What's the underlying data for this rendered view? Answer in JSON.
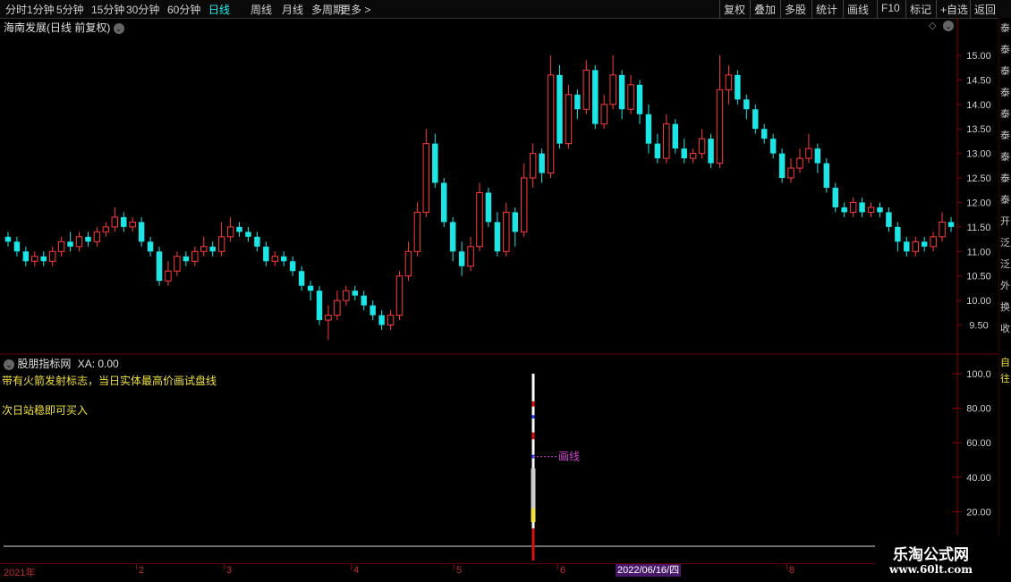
{
  "toolbar": {
    "left_items": [
      "分时",
      "1分钟",
      "5分钟",
      "15分钟",
      "30分钟",
      "60分钟",
      "日线",
      "周线",
      "月线",
      "多周期",
      "更多 >"
    ],
    "active": "日线",
    "right_items": [
      "复权",
      "叠加",
      "多股",
      "统计",
      "画线",
      "F10",
      "标记",
      "+自选",
      "返回"
    ]
  },
  "main_pane": {
    "title": "海南发展(日线 前复权)",
    "y_ticks": [
      "15.00",
      "14.50",
      "14.00",
      "13.50",
      "13.00",
      "12.50",
      "12.00",
      "11.50",
      "11.00",
      "10.50",
      "10.00",
      "9.50"
    ]
  },
  "indicator_pane": {
    "title": "股朋指标网",
    "value": "XA: 0.00",
    "note1": "带有火箭发射标志，当日实体最高价画试盘线",
    "note2": "次日站稳即可买入",
    "line_label": "画线",
    "y_ticks": [
      "100.0",
      "80.00",
      "60.00",
      "40.00",
      "20.00"
    ]
  },
  "x_axis": {
    "months": [
      "2021年",
      "2",
      "3",
      "4",
      "5",
      "6",
      "8"
    ],
    "cursor_date": "2022/06/16/四"
  },
  "right_strip_glyphs": [
    "泰",
    "泰",
    "泰",
    "泰",
    "泰",
    "泰",
    "泰",
    "泰",
    "泰",
    "开",
    "泛",
    "泛",
    "外",
    "换",
    "收"
  ],
  "right_strip_glyphs_lower": [
    "自",
    "往"
  ],
  "logo": {
    "name": "乐淘公式网",
    "url": "www.60lt.com"
  },
  "colors": {
    "up": "#ff3b3b",
    "down": "#1ee5e5",
    "accent": "#1ef0f0",
    "note": "#f0e040",
    "grid": "#5a0000"
  },
  "chart_data": {
    "type": "candlestick",
    "ylim": [
      9.2,
      15.4
    ],
    "series": [
      {
        "o": 11.3,
        "c": 11.2,
        "h": 11.4,
        "l": 11.1
      },
      {
        "o": 11.2,
        "c": 11.0,
        "h": 11.3,
        "l": 10.9
      },
      {
        "o": 11.0,
        "c": 10.8,
        "h": 11.1,
        "l": 10.7
      },
      {
        "o": 10.8,
        "c": 10.9,
        "h": 11.0,
        "l": 10.7
      },
      {
        "o": 10.9,
        "c": 10.8,
        "h": 11.0,
        "l": 10.7
      },
      {
        "o": 10.8,
        "c": 11.0,
        "h": 11.1,
        "l": 10.7
      },
      {
        "o": 11.0,
        "c": 11.2,
        "h": 11.3,
        "l": 10.9
      },
      {
        "o": 11.2,
        "c": 11.1,
        "h": 11.4,
        "l": 11.0
      },
      {
        "o": 11.1,
        "c": 11.3,
        "h": 11.4,
        "l": 11.0
      },
      {
        "o": 11.3,
        "c": 11.2,
        "h": 11.4,
        "l": 11.1
      },
      {
        "o": 11.2,
        "c": 11.4,
        "h": 11.5,
        "l": 11.1
      },
      {
        "o": 11.4,
        "c": 11.5,
        "h": 11.6,
        "l": 11.3
      },
      {
        "o": 11.5,
        "c": 11.7,
        "h": 11.9,
        "l": 11.4
      },
      {
        "o": 11.7,
        "c": 11.5,
        "h": 11.8,
        "l": 11.4
      },
      {
        "o": 11.5,
        "c": 11.6,
        "h": 11.7,
        "l": 11.4
      },
      {
        "o": 11.6,
        "c": 11.2,
        "h": 11.7,
        "l": 11.1
      },
      {
        "o": 11.2,
        "c": 11.0,
        "h": 11.3,
        "l": 10.9
      },
      {
        "o": 11.0,
        "c": 10.4,
        "h": 11.1,
        "l": 10.3
      },
      {
        "o": 10.4,
        "c": 10.6,
        "h": 10.8,
        "l": 10.3
      },
      {
        "o": 10.6,
        "c": 10.9,
        "h": 11.0,
        "l": 10.5
      },
      {
        "o": 10.9,
        "c": 10.8,
        "h": 11.0,
        "l": 10.7
      },
      {
        "o": 10.8,
        "c": 11.0,
        "h": 11.1,
        "l": 10.7
      },
      {
        "o": 11.0,
        "c": 11.1,
        "h": 11.3,
        "l": 10.9
      },
      {
        "o": 11.1,
        "c": 11.0,
        "h": 11.2,
        "l": 10.9
      },
      {
        "o": 11.0,
        "c": 11.3,
        "h": 11.6,
        "l": 10.9
      },
      {
        "o": 11.3,
        "c": 11.5,
        "h": 11.7,
        "l": 11.2
      },
      {
        "o": 11.5,
        "c": 11.4,
        "h": 11.6,
        "l": 11.3
      },
      {
        "o": 11.4,
        "c": 11.3,
        "h": 11.5,
        "l": 11.2
      },
      {
        "o": 11.3,
        "c": 11.1,
        "h": 11.4,
        "l": 11.0
      },
      {
        "o": 11.1,
        "c": 10.8,
        "h": 11.2,
        "l": 10.7
      },
      {
        "o": 10.8,
        "c": 10.9,
        "h": 11.0,
        "l": 10.7
      },
      {
        "o": 10.9,
        "c": 10.8,
        "h": 11.0,
        "l": 10.7
      },
      {
        "o": 10.8,
        "c": 10.6,
        "h": 10.9,
        "l": 10.5
      },
      {
        "o": 10.6,
        "c": 10.3,
        "h": 10.7,
        "l": 10.2
      },
      {
        "o": 10.3,
        "c": 10.2,
        "h": 10.4,
        "l": 10.0
      },
      {
        "o": 10.2,
        "c": 9.6,
        "h": 10.3,
        "l": 9.5
      },
      {
        "o": 9.6,
        "c": 9.7,
        "h": 9.9,
        "l": 9.2
      },
      {
        "o": 9.7,
        "c": 10.0,
        "h": 10.2,
        "l": 9.6
      },
      {
        "o": 10.0,
        "c": 10.2,
        "h": 10.3,
        "l": 9.9
      },
      {
        "o": 10.2,
        "c": 10.1,
        "h": 10.3,
        "l": 10.0
      },
      {
        "o": 10.1,
        "c": 9.9,
        "h": 10.2,
        "l": 9.8
      },
      {
        "o": 9.9,
        "c": 9.7,
        "h": 10.0,
        "l": 9.6
      },
      {
        "o": 9.7,
        "c": 9.5,
        "h": 9.8,
        "l": 9.4
      },
      {
        "o": 9.5,
        "c": 9.7,
        "h": 9.8,
        "l": 9.4
      },
      {
        "o": 9.7,
        "c": 10.5,
        "h": 10.6,
        "l": 9.6
      },
      {
        "o": 10.5,
        "c": 11.0,
        "h": 11.2,
        "l": 10.4
      },
      {
        "o": 11.0,
        "c": 11.8,
        "h": 12.0,
        "l": 10.9
      },
      {
        "o": 11.8,
        "c": 13.2,
        "h": 13.5,
        "l": 11.7
      },
      {
        "o": 13.2,
        "c": 12.4,
        "h": 13.4,
        "l": 12.3
      },
      {
        "o": 12.4,
        "c": 11.6,
        "h": 12.5,
        "l": 11.5
      },
      {
        "o": 11.6,
        "c": 11.0,
        "h": 11.7,
        "l": 10.8
      },
      {
        "o": 11.0,
        "c": 10.7,
        "h": 11.2,
        "l": 10.5
      },
      {
        "o": 10.7,
        "c": 11.1,
        "h": 11.3,
        "l": 10.6
      },
      {
        "o": 11.1,
        "c": 12.2,
        "h": 12.4,
        "l": 11.0
      },
      {
        "o": 12.2,
        "c": 11.6,
        "h": 12.3,
        "l": 11.5
      },
      {
        "o": 11.6,
        "c": 11.0,
        "h": 11.8,
        "l": 10.9
      },
      {
        "o": 11.0,
        "c": 11.8,
        "h": 12.0,
        "l": 10.9
      },
      {
        "o": 11.8,
        "c": 11.4,
        "h": 11.9,
        "l": 11.1
      },
      {
        "o": 11.4,
        "c": 12.5,
        "h": 12.8,
        "l": 11.3
      },
      {
        "o": 12.5,
        "c": 13.0,
        "h": 13.2,
        "l": 12.3
      },
      {
        "o": 13.0,
        "c": 12.6,
        "h": 13.1,
        "l": 12.4
      },
      {
        "o": 12.6,
        "c": 14.6,
        "h": 15.0,
        "l": 12.5
      },
      {
        "o": 14.6,
        "c": 13.2,
        "h": 14.8,
        "l": 13.1
      },
      {
        "o": 13.2,
        "c": 14.2,
        "h": 14.4,
        "l": 13.1
      },
      {
        "o": 14.2,
        "c": 13.9,
        "h": 14.3,
        "l": 13.7
      },
      {
        "o": 13.9,
        "c": 14.7,
        "h": 14.9,
        "l": 13.8
      },
      {
        "o": 14.7,
        "c": 13.6,
        "h": 14.8,
        "l": 13.5
      },
      {
        "o": 13.6,
        "c": 14.0,
        "h": 14.2,
        "l": 13.5
      },
      {
        "o": 14.0,
        "c": 14.6,
        "h": 15.0,
        "l": 13.9
      },
      {
        "o": 14.6,
        "c": 13.9,
        "h": 14.7,
        "l": 13.7
      },
      {
        "o": 13.9,
        "c": 14.4,
        "h": 14.6,
        "l": 13.8
      },
      {
        "o": 14.4,
        "c": 13.8,
        "h": 14.5,
        "l": 13.6
      },
      {
        "o": 13.8,
        "c": 13.2,
        "h": 14.0,
        "l": 13.0
      },
      {
        "o": 13.2,
        "c": 12.9,
        "h": 13.4,
        "l": 12.8
      },
      {
        "o": 12.9,
        "c": 13.6,
        "h": 13.8,
        "l": 12.8
      },
      {
        "o": 13.6,
        "c": 13.1,
        "h": 13.7,
        "l": 13.0
      },
      {
        "o": 13.1,
        "c": 12.9,
        "h": 13.3,
        "l": 12.8
      },
      {
        "o": 12.9,
        "c": 13.0,
        "h": 13.1,
        "l": 12.8
      },
      {
        "o": 13.0,
        "c": 13.3,
        "h": 13.5,
        "l": 12.9
      },
      {
        "o": 13.3,
        "c": 12.8,
        "h": 13.4,
        "l": 12.7
      },
      {
        "o": 12.8,
        "c": 14.3,
        "h": 15.0,
        "l": 12.7
      },
      {
        "o": 14.3,
        "c": 14.6,
        "h": 14.8,
        "l": 14.0
      },
      {
        "o": 14.6,
        "c": 14.1,
        "h": 14.7,
        "l": 14.0
      },
      {
        "o": 14.1,
        "c": 13.9,
        "h": 14.2,
        "l": 13.7
      },
      {
        "o": 13.9,
        "c": 13.5,
        "h": 14.0,
        "l": 13.4
      },
      {
        "o": 13.5,
        "c": 13.3,
        "h": 13.6,
        "l": 13.2
      },
      {
        "o": 13.3,
        "c": 13.0,
        "h": 13.4,
        "l": 12.9
      },
      {
        "o": 13.0,
        "c": 12.5,
        "h": 13.1,
        "l": 12.4
      },
      {
        "o": 12.5,
        "c": 12.7,
        "h": 12.9,
        "l": 12.4
      },
      {
        "o": 12.7,
        "c": 12.9,
        "h": 13.1,
        "l": 12.6
      },
      {
        "o": 12.9,
        "c": 13.1,
        "h": 13.4,
        "l": 12.8
      },
      {
        "o": 13.1,
        "c": 12.8,
        "h": 13.2,
        "l": 12.6
      },
      {
        "o": 12.8,
        "c": 12.3,
        "h": 12.9,
        "l": 12.2
      },
      {
        "o": 12.3,
        "c": 11.9,
        "h": 12.4,
        "l": 11.8
      },
      {
        "o": 11.9,
        "c": 11.8,
        "h": 12.0,
        "l": 11.7
      },
      {
        "o": 11.8,
        "c": 12.0,
        "h": 12.1,
        "l": 11.7
      },
      {
        "o": 12.0,
        "c": 11.8,
        "h": 12.1,
        "l": 11.7
      },
      {
        "o": 11.8,
        "c": 11.9,
        "h": 12.0,
        "l": 11.7
      },
      {
        "o": 11.9,
        "c": 11.8,
        "h": 12.0,
        "l": 11.7
      },
      {
        "o": 11.8,
        "c": 11.5,
        "h": 11.9,
        "l": 11.4
      },
      {
        "o": 11.5,
        "c": 11.2,
        "h": 11.6,
        "l": 11.0
      },
      {
        "o": 11.2,
        "c": 11.0,
        "h": 11.3,
        "l": 10.9
      },
      {
        "o": 11.0,
        "c": 11.2,
        "h": 11.3,
        "l": 10.9
      },
      {
        "o": 11.2,
        "c": 11.1,
        "h": 11.3,
        "l": 11.0
      },
      {
        "o": 11.1,
        "c": 11.3,
        "h": 11.4,
        "l": 11.0
      },
      {
        "o": 11.3,
        "c": 11.6,
        "h": 11.8,
        "l": 11.2
      },
      {
        "o": 11.6,
        "c": 11.5,
        "h": 11.7,
        "l": 11.4
      }
    ]
  }
}
